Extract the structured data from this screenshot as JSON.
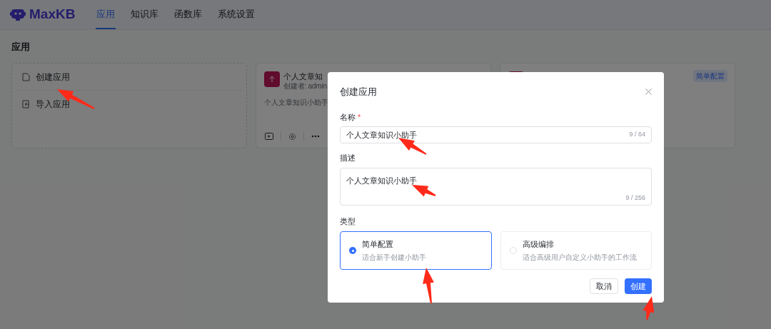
{
  "nav": {
    "logo": "MaxKB",
    "tabs": [
      {
        "label": "应用",
        "selected": true
      },
      {
        "label": "知识库",
        "selected": false
      },
      {
        "label": "函数库",
        "selected": false
      },
      {
        "label": "系统设置",
        "selected": false
      }
    ]
  },
  "page_title": "应用",
  "create_card": {
    "items": [
      {
        "kind": "create",
        "label": "创建应用"
      },
      {
        "kind": "import",
        "label": "导入应用"
      }
    ]
  },
  "app_cards": [
    {
      "title": "个人文章知",
      "creator": "创建者: admin",
      "description": "个人文章知识小助手"
    },
    {
      "badge": "简单配置"
    }
  ],
  "dialog": {
    "title": "创建应用",
    "name_label": "名称",
    "name_required": "*",
    "name_value": "个人文章知识小助手",
    "name_count": "9 / 64",
    "desc_label": "描述",
    "desc_value": "个人文章知识小助手",
    "desc_count": "9 / 256",
    "type_label": "类型",
    "types": [
      {
        "title": "简单配置",
        "subtitle": "适合新手创建小助手",
        "selected": true
      },
      {
        "title": "高级编排",
        "subtitle": "适合高级用户自定义小助手的工作流",
        "selected": false
      }
    ],
    "cancel": "取消",
    "confirm": "创建"
  }
}
